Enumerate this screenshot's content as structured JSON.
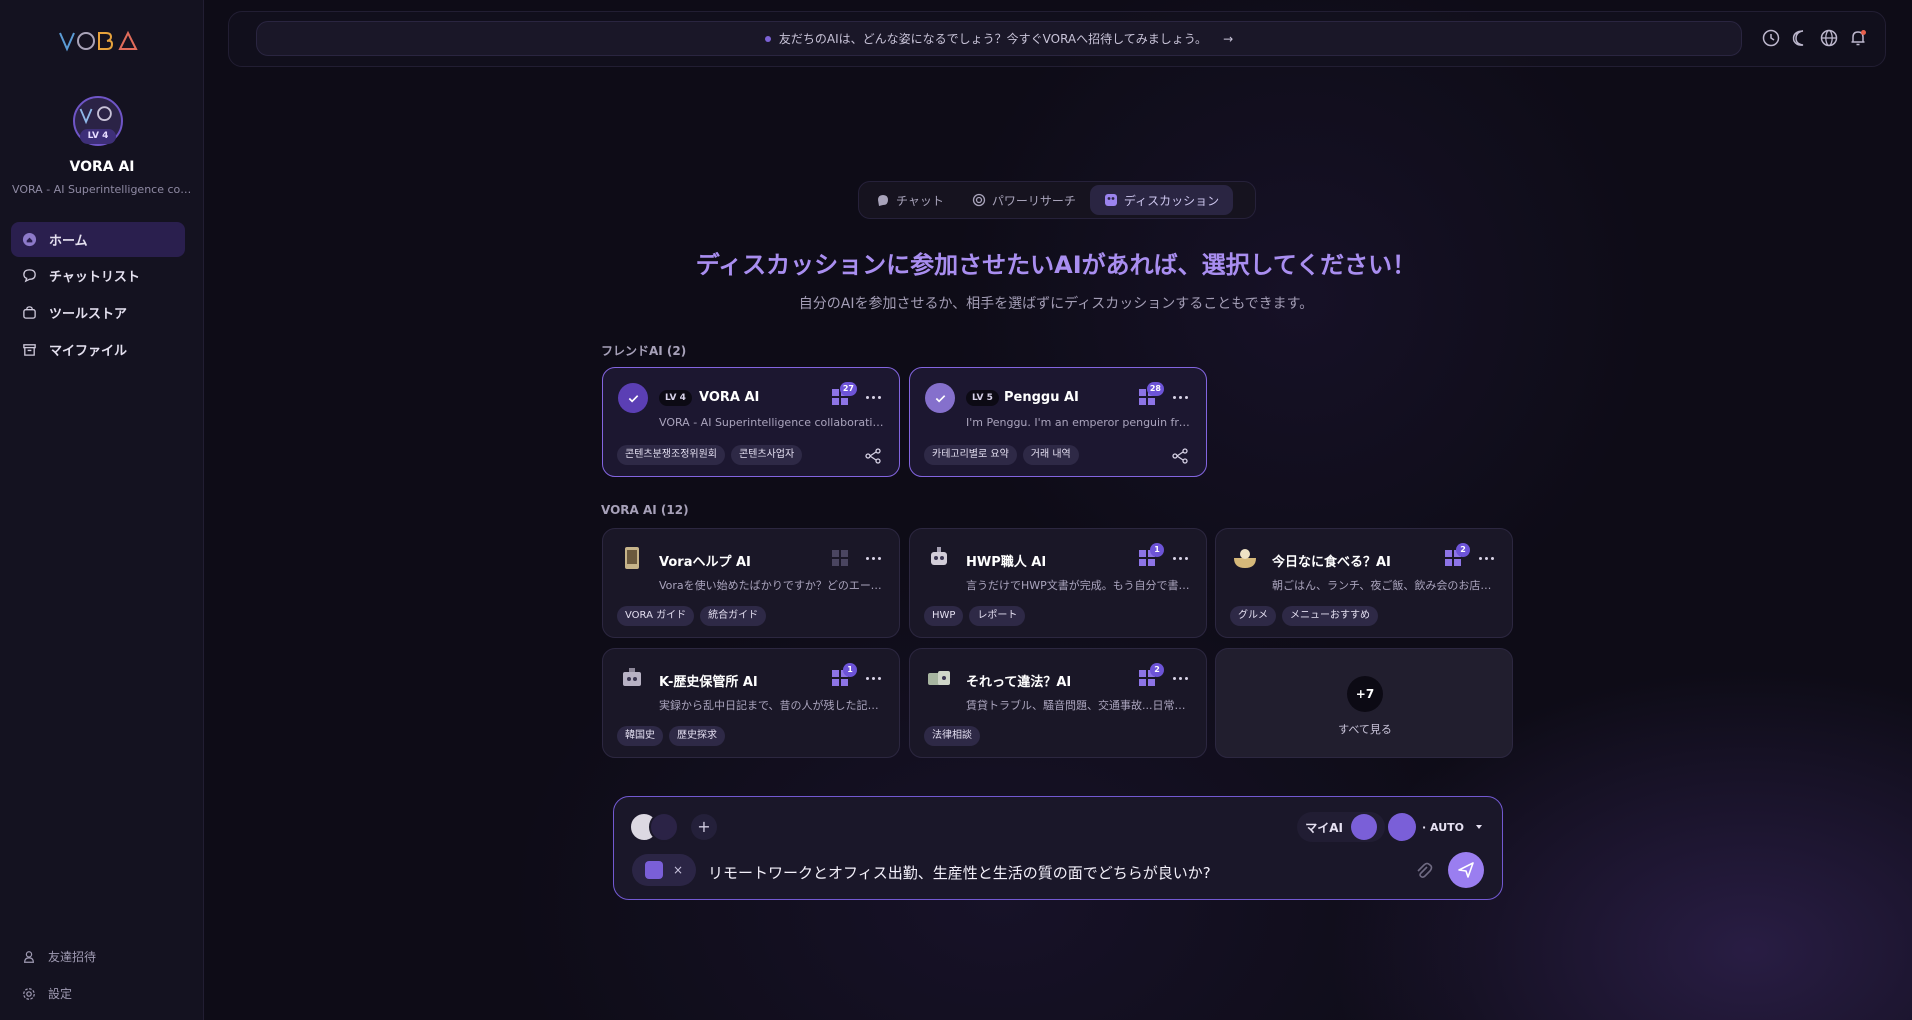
{
  "brand": "VORA",
  "sidebar": {
    "profile": {
      "name": "VORA AI",
      "level": "LV 4",
      "desc": "VORA - AI Superintelligence coll..."
    },
    "nav": [
      {
        "label": "ホーム",
        "icon": "home-icon",
        "active": true
      },
      {
        "label": "チャットリスト",
        "icon": "chat-icon",
        "active": false
      },
      {
        "label": "ツールストア",
        "icon": "store-icon",
        "active": false
      },
      {
        "label": "マイファイル",
        "icon": "archive-icon",
        "active": false
      }
    ],
    "footer": [
      {
        "label": "友達招待",
        "icon": "user-icon"
      },
      {
        "label": "設定",
        "icon": "gear-icon"
      }
    ]
  },
  "topbar": {
    "announcement": "友だちのAIは、どんな姿になるでしょう？今すぐVORAへ招待してみましょう。",
    "arrow": "→"
  },
  "tabs": [
    {
      "label": "チャット",
      "active": false
    },
    {
      "label": "パワーリサーチ",
      "active": false
    },
    {
      "label": "ディスカッション",
      "active": true
    }
  ],
  "headline": "ディスカッションに参加させたいAIがあれば、選択してください！",
  "subline": "自分のAIを参加させるか、相手を選ばずにディスカッションすることもできます。",
  "friend_section": "フレンドAI (2)",
  "friend_cards": [
    {
      "level": "LV 4",
      "name": "VORA AI",
      "tools": "27",
      "desc": "VORA - AI Superintelligence collaborating wi...",
      "tags": [
        "콘텐츠분쟁조정위원회",
        "콘텐츠사업자"
      ]
    },
    {
      "level": "LV 5",
      "name": "Penggu AI",
      "tools": "28",
      "desc": "I'm Penggu. I'm an emperor penguin from An...",
      "tags": [
        "카테고리별로 요약",
        "거래 내역"
      ]
    }
  ],
  "vora_section": "VORA AI (12)",
  "vora_cards": [
    {
      "name": "Voraヘルプ AI",
      "tools": "",
      "desc": "Voraを使い始めたばかりですか？どのエージ...",
      "tags": [
        "VORA ガイド",
        "統合ガイド"
      ]
    },
    {
      "name": "HWP職人 AI",
      "tools": "1",
      "desc": "言うだけでHWP文書が完成。もう自分で書く...",
      "tags": [
        "HWP",
        "レポート"
      ]
    },
    {
      "name": "今日なに食べる？AI",
      "tools": "2",
      "desc": "朝ごはん、ランチ、夜ご飯、飲み会のお店ま...",
      "tags": [
        "グルメ",
        "メニューおすすめ"
      ]
    },
    {
      "name": "K-歴史保管所 AI",
      "tools": "1",
      "desc": "実録から乱中日記まで、昔の人が残した記録...",
      "tags": [
        "韓国史",
        "歴史探求"
      ]
    },
    {
      "name": "それって違法？AI",
      "tools": "2",
      "desc": "賃貸トラブル、騒音問題、交通事故...日常に...",
      "tags": [
        "法律相談"
      ]
    }
  ],
  "see_all": {
    "count": "+7",
    "label": "すべて見る"
  },
  "composer": {
    "plus": "+",
    "my_ai": "マイAI",
    "mode": "· AUTO",
    "close": "×",
    "input": "リモートワークとオフィス出勤、生産性と生活の質の面でどちらが良いか?"
  },
  "colors": {
    "accent": "#8365e0",
    "headline": "#a98ef0",
    "send": "#9a7ef0"
  }
}
